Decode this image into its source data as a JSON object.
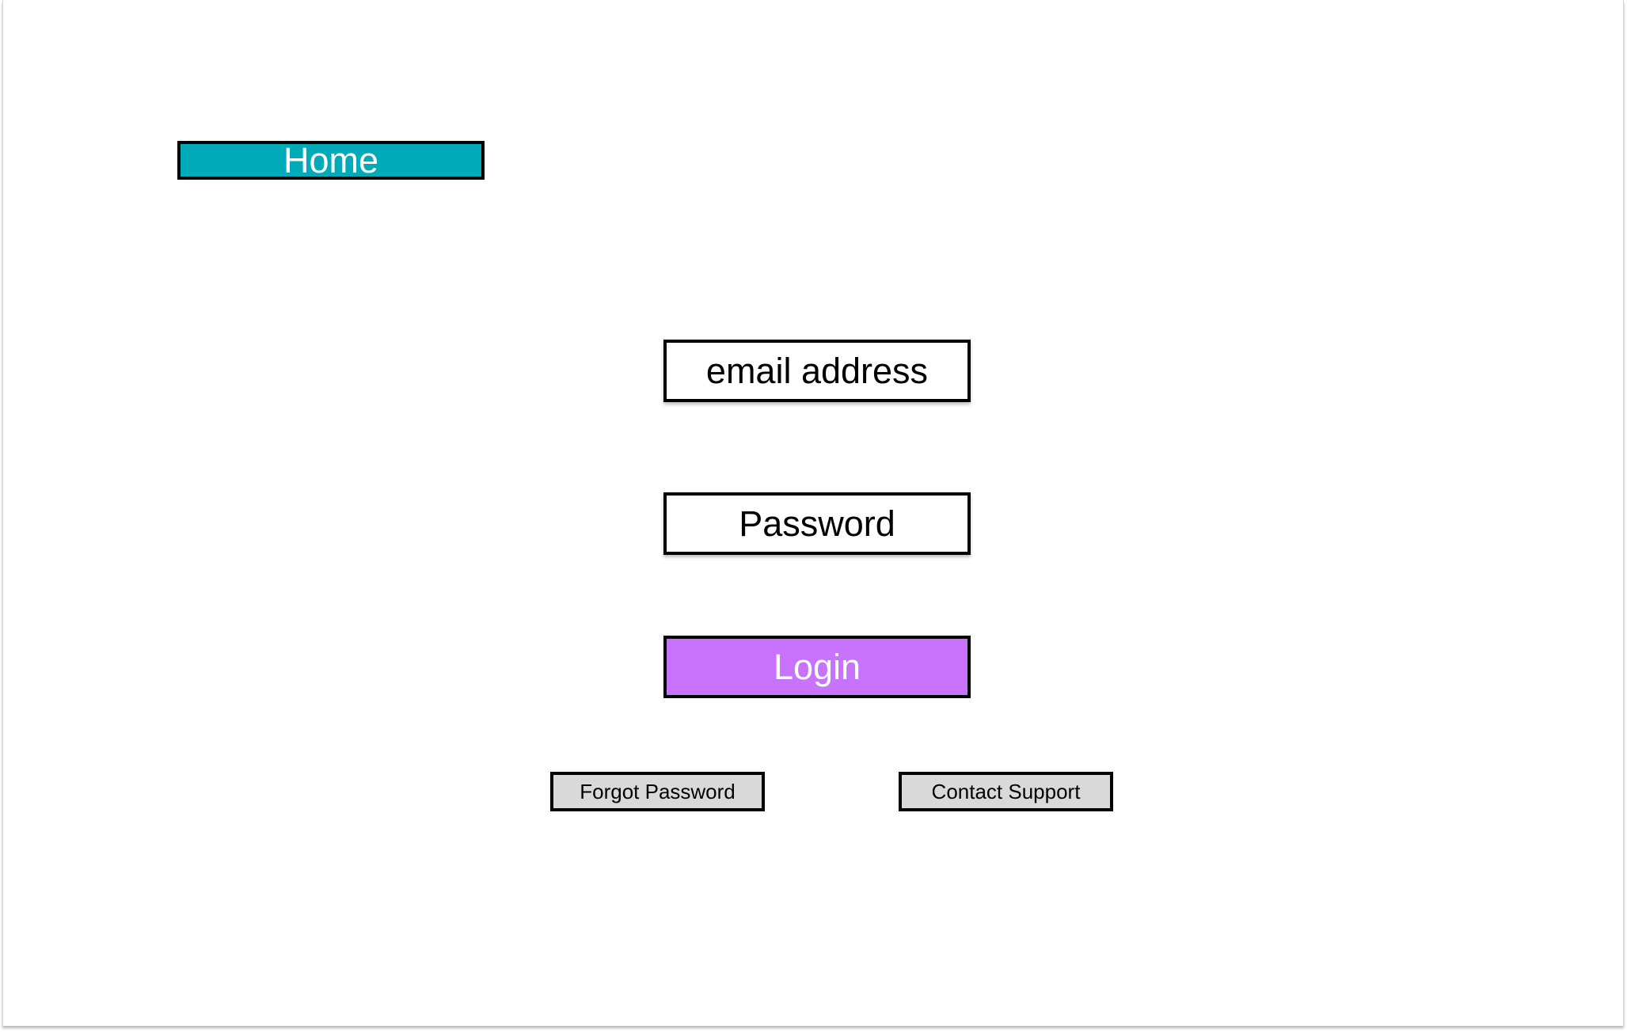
{
  "nav": {
    "home_label": "Home"
  },
  "login_form": {
    "email_label": "email address",
    "password_label": "Password",
    "login_label": "Login",
    "forgot_password_label": "Forgot Password",
    "contact_support_label": "Contact Support"
  },
  "colors": {
    "home_button": "#00abb9",
    "login_button": "#c773fd",
    "secondary_button": "#d9d9d9",
    "border": "#000000"
  }
}
